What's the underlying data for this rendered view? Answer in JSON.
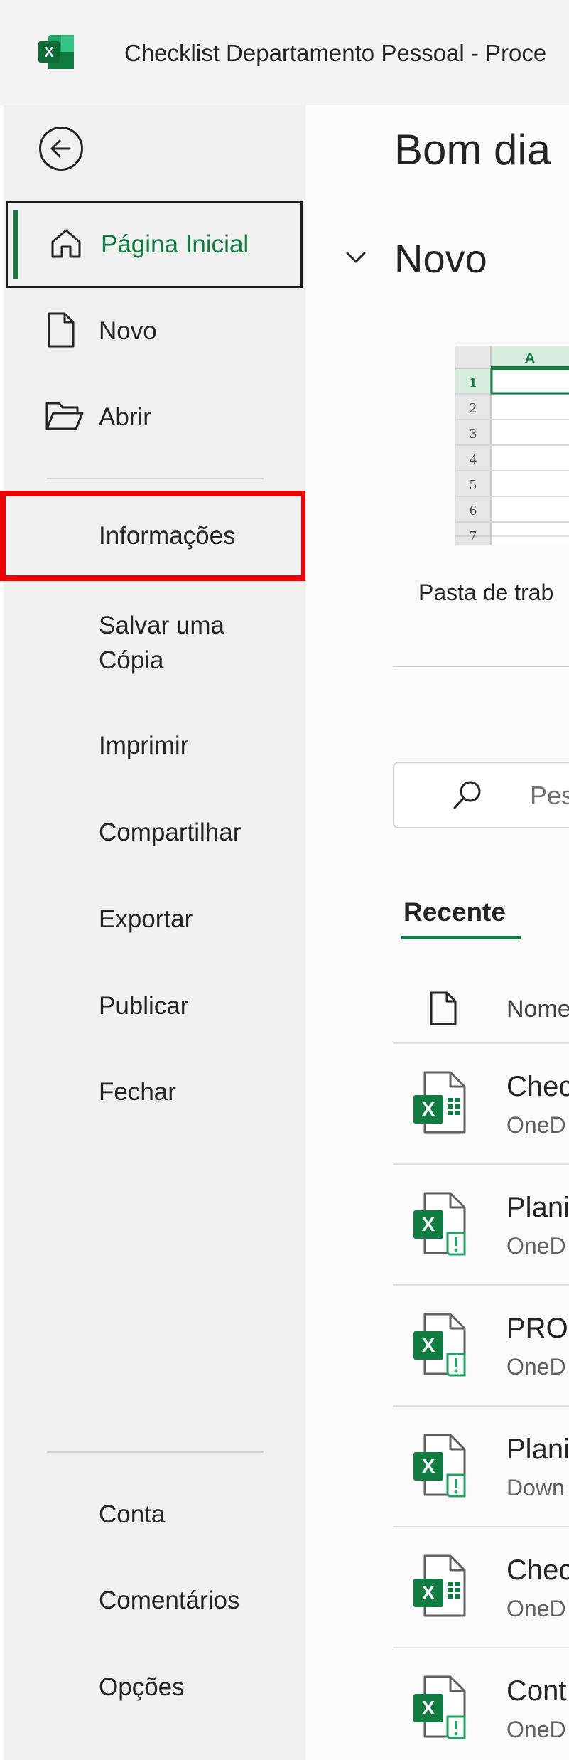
{
  "window": {
    "title": "Checklist Departamento Pessoal - Proce"
  },
  "nav": {
    "items": [
      {
        "label": "Página Inicial"
      },
      {
        "label": "Novo"
      },
      {
        "label": "Abrir"
      },
      {
        "label": "Informações"
      },
      {
        "label": "Salvar uma Cópia"
      },
      {
        "label": "Imprimir"
      },
      {
        "label": "Compartilhar"
      },
      {
        "label": "Exportar"
      },
      {
        "label": "Publicar"
      },
      {
        "label": "Fechar"
      }
    ],
    "bottom": [
      {
        "label": "Conta"
      },
      {
        "label": "Comentários"
      },
      {
        "label": "Opções"
      }
    ]
  },
  "main": {
    "greeting": "Bom dia",
    "new_section": "Novo",
    "template": {
      "label": "Pasta de trab",
      "column": "A",
      "rows": [
        "1",
        "2",
        "3",
        "4",
        "5",
        "6",
        "7"
      ]
    },
    "search_placeholder": "Pes",
    "tabs": [
      {
        "label": "Recente"
      }
    ],
    "table_header": {
      "name": "Nome"
    },
    "files": [
      {
        "name": "Chec",
        "location": "OneD",
        "icon": "excel-file-icon"
      },
      {
        "name": "Plani",
        "location": "OneD",
        "icon": "excel-file-warning-icon"
      },
      {
        "name": "PRO",
        "location": "OneD",
        "icon": "excel-file-warning-icon"
      },
      {
        "name": "Plani",
        "location": "Down",
        "icon": "excel-file-warning-icon"
      },
      {
        "name": "Chec",
        "location": "OneD",
        "icon": "excel-file-icon"
      },
      {
        "name": "Cont",
        "location": "OneD",
        "icon": "excel-file-warning-icon"
      }
    ]
  },
  "colors": {
    "accent": "#107c41",
    "highlight": "#ee0000"
  }
}
